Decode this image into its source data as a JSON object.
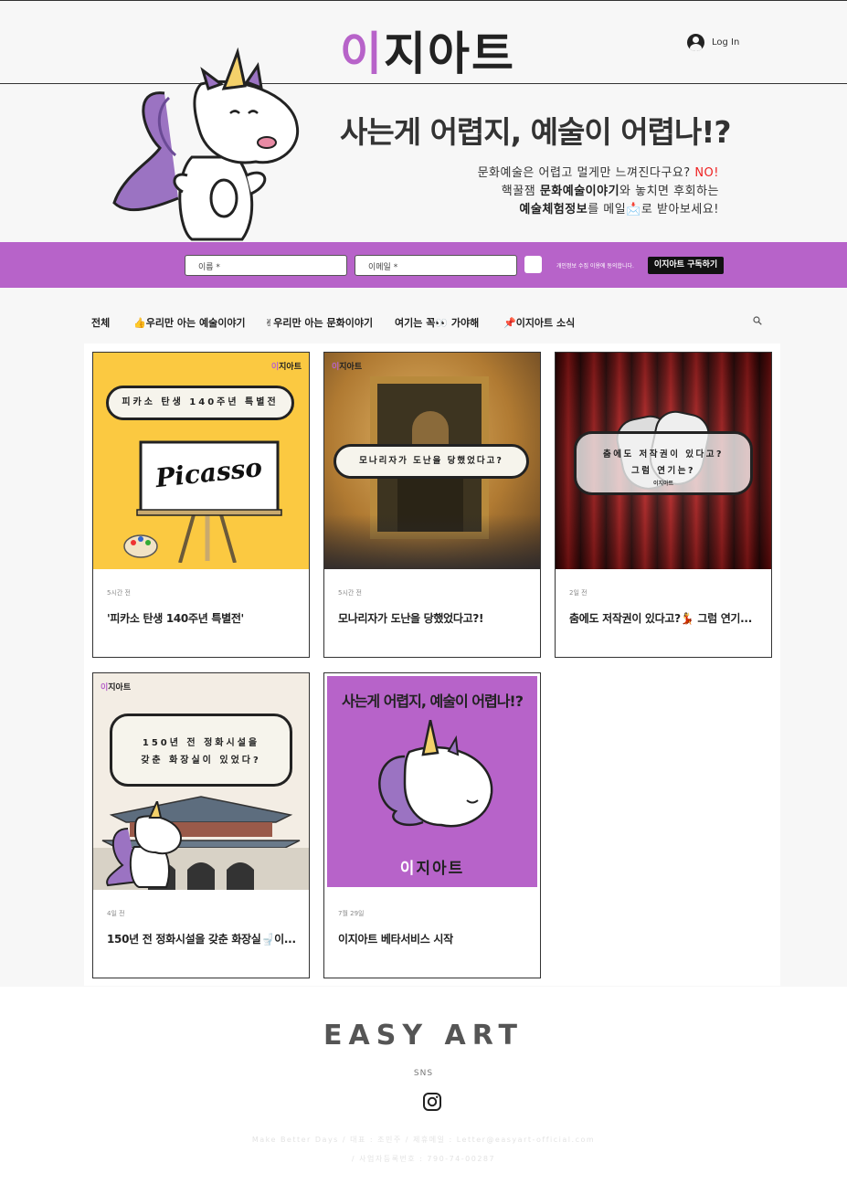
{
  "header": {
    "logo_accent": "이",
    "logo_rest": "지아트",
    "login_label": "Log In"
  },
  "hero": {
    "title": "사는게 어렵지, 예술이 어렵나!?",
    "line1_a": "문화예술은 어렵고 멀게만 느껴진다구요? ",
    "line1_no": "NO!",
    "line2_a": "핵꿀잼 ",
    "line2_b": "문화예술이야기",
    "line2_c": "와 놓치면 후회하는",
    "line3_a": "예술체험정보",
    "line3_b": "를 메일📩로 받아보세요!"
  },
  "subscribe": {
    "name_placeholder": "이름 *",
    "email_placeholder": "이메일 *",
    "consent": "개인정보 수집 이용에 동의합니다.",
    "button": "이지아트 구독하기"
  },
  "categories": [
    "전체",
    "👍우리만 아는 예술이야기",
    "✌우리만 아는 문화이야기",
    "여기는 꼭👀 가야해",
    "📌이지아트 소식"
  ],
  "posts": [
    {
      "time": "5시간 전",
      "title": "'피카소 탄생 140주년 특별전'",
      "bubble": "피카소 탄생 140주년 특별전",
      "sign": "Picasso",
      "tag_a": "이",
      "tag_b": "지아트"
    },
    {
      "time": "5시간 전",
      "title": "모나리자가 도난을 당했었다고?!",
      "bubble": "모나리자가 도난을 당했었다고?",
      "tag_a": "이",
      "tag_b": "지아트"
    },
    {
      "time": "2일 전",
      "title": "춤에도 저작권이 있다고?💃 그럼 연기...",
      "bubble1": "춤에도 저작권이 있다고?",
      "bubble2": "그럼 연기는?",
      "tag": "이지아트"
    },
    {
      "time": "4일 전",
      "title": "150년 전 정화시설을 갖춘 화장실🚽이...",
      "bubble1": "150년 전 정화시설을",
      "bubble2": "갖춘 화장실이 있었다?",
      "tag_a": "이",
      "tag_b": "지아트"
    },
    {
      "time": "7월 29일",
      "title": "이지아트 베타서비스 시작",
      "img_title": "사는게 어렵지, 예술이 어렵나!?",
      "img_logo_a": "이",
      "img_logo_b": "지아트"
    }
  ],
  "footer": {
    "brand": "EASY ART",
    "sns": "SNS",
    "line1": "Make Better Days / 대표 : 조민주 / 제휴메일 : Letter@easyart-official.com",
    "line2": "/ 사업자등록번호 : 790-74-00287"
  },
  "colors": {
    "accent": "#b763c9",
    "background": "#f7f7f7"
  },
  "icons": [
    "user-avatar-icon",
    "search-icon",
    "instagram-icon"
  ]
}
